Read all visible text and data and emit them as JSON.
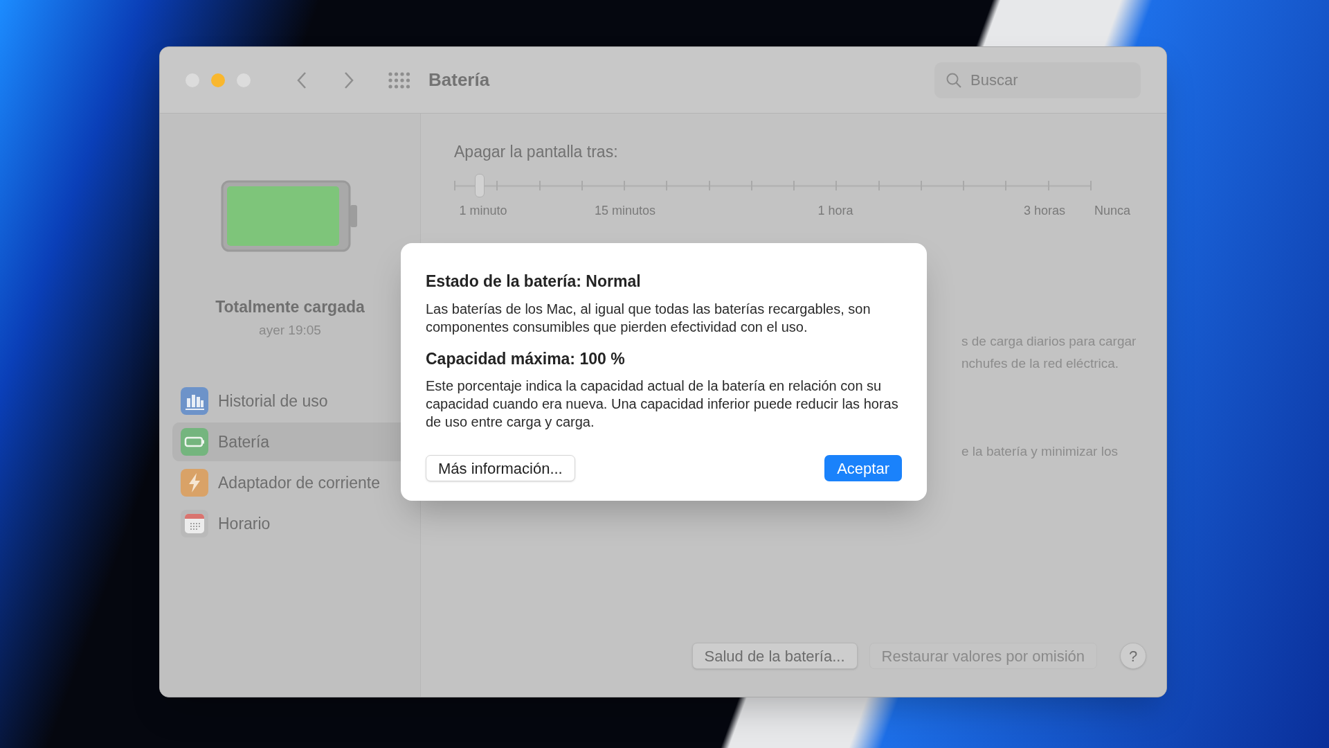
{
  "window": {
    "title": "Batería",
    "traffic_lights": [
      {
        "color": "#dcdcdc"
      },
      {
        "color": "#f9b72e"
      },
      {
        "color": "#dcdcdc"
      }
    ],
    "search": {
      "placeholder": "Buscar"
    }
  },
  "sidebar": {
    "battery_status": "Totalmente cargada",
    "battery_time": "ayer 19:05",
    "items": [
      {
        "label": "Historial de uso",
        "kind": "chart",
        "selected": false
      },
      {
        "label": "Batería",
        "kind": "battery",
        "selected": true
      },
      {
        "label": "Adaptador de corriente",
        "kind": "power",
        "selected": false
      },
      {
        "label": "Horario",
        "kind": "calendar",
        "selected": false
      }
    ]
  },
  "display_off": {
    "label": "Apagar la pantalla tras:",
    "level": 0.04,
    "ticks": [
      "1 minuto",
      "15 minutos",
      "1 hora",
      "3 horas",
      "Nunca"
    ]
  },
  "hidden_text": [
    {
      "lines": [
        "s de carga diarios para cargar",
        "nchufes de la red eléctrica."
      ]
    },
    {
      "lines": [
        "e la batería y minimizar los"
      ]
    }
  ],
  "buttons": [
    {
      "label": "Salud de la batería...",
      "disabled": false
    },
    {
      "label": "Restaurar valores por omisión",
      "disabled": true
    },
    {
      "label": "?",
      "disabled": false
    }
  ],
  "dialog": {
    "title": "Estado de la batería: Normal",
    "text": "Las baterías de los Mac, al igual que todas las baterías recargables, son componentes consumibles que pierden efectividad con el uso.",
    "subtitle": "Capacidad máxima: 100 %",
    "subtext": "Este porcentaje indica la capacidad actual de la batería en relación con su capacidad cuando era nueva. Una capacidad inferior puede reducir las horas de uso entre carga y carga.",
    "secondary_button": "Más información...",
    "primary_button": "Aceptar"
  }
}
